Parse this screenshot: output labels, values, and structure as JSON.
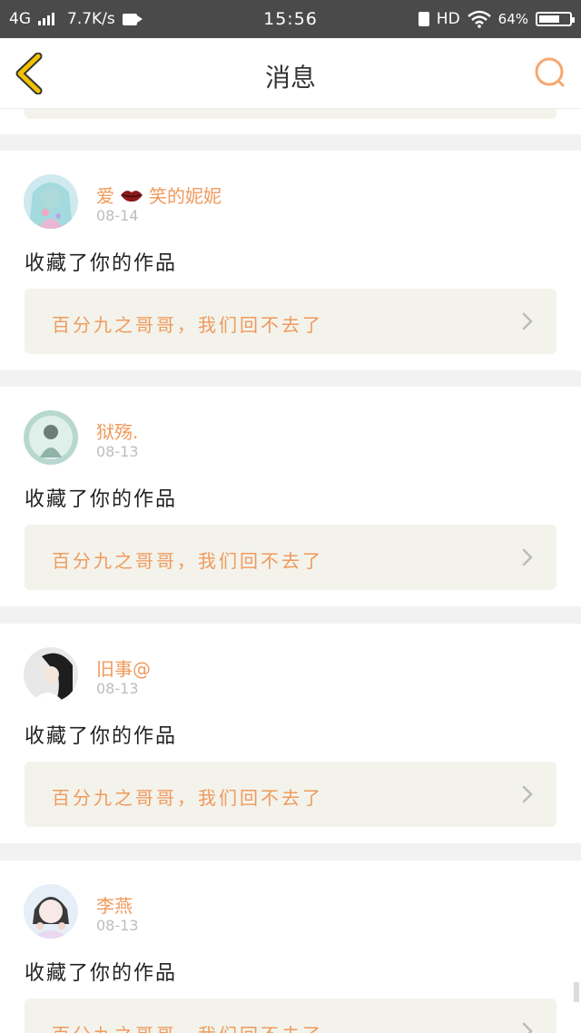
{
  "status_bar": {
    "network": "4G",
    "speed": "7.7K/s",
    "time": "15:56",
    "hd": "HD",
    "battery": "64%"
  },
  "header": {
    "title": "消息"
  },
  "colors": {
    "accent_orange": "#f09a5c",
    "back_icon_yellow": "#f2c200",
    "link_bg": "#f3f3ec"
  },
  "messages": [
    {
      "user_prefix": "爱",
      "user_suffix": "笑的妮妮",
      "icon": "lips-icon",
      "date": "08-14",
      "action": "收藏了你的作品",
      "work_title": "百分九之哥哥，我们回不去了"
    },
    {
      "user_prefix": "",
      "user_suffix": "狱殇.",
      "date": "08-13",
      "action": "收藏了你的作品",
      "work_title": "百分九之哥哥，我们回不去了"
    },
    {
      "user_prefix": "",
      "user_suffix": "旧事@",
      "date": "08-13",
      "action": "收藏了你的作品",
      "work_title": "百分九之哥哥，我们回不去了"
    },
    {
      "user_prefix": "",
      "user_suffix": "李燕",
      "date": "08-13",
      "action": "收藏了你的作品",
      "work_title": "百分九之哥哥，我们回不去了"
    }
  ]
}
